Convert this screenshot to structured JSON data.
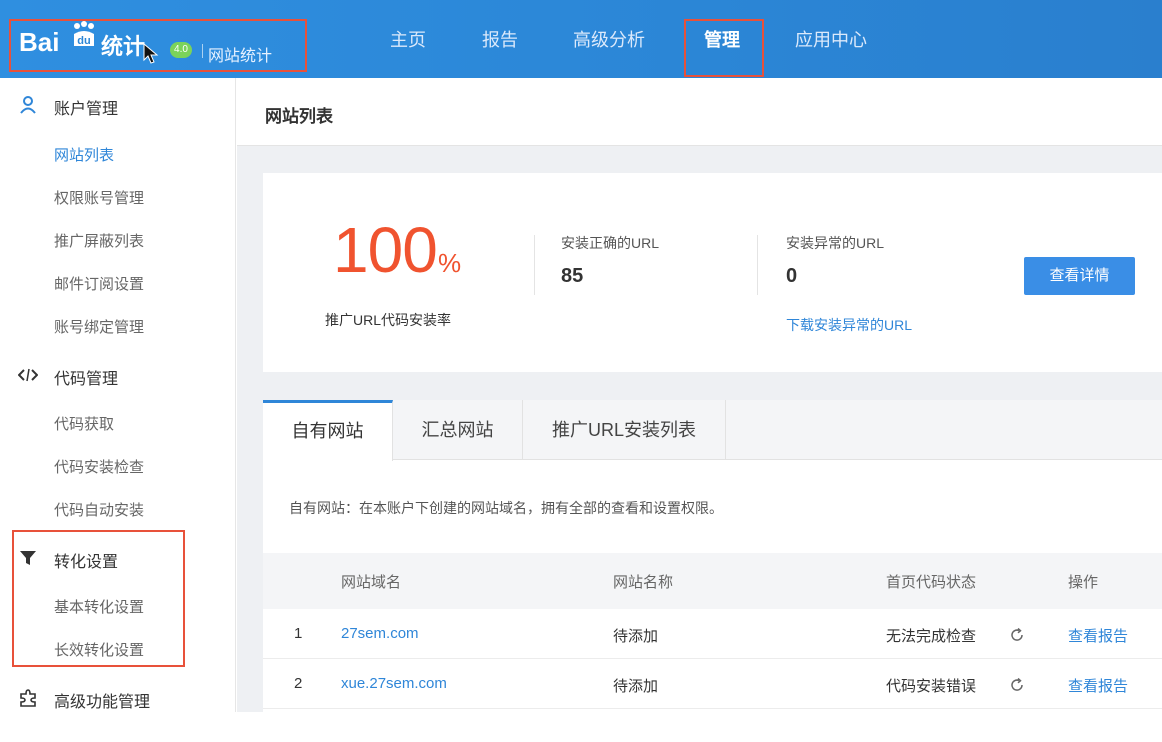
{
  "brand": {
    "logo_text_bai": "Bai",
    "logo_text_tongji": "统计",
    "badge": "4.0",
    "site_label": "网站统计"
  },
  "nav": {
    "items": [
      {
        "label": "主页"
      },
      {
        "label": "报告"
      },
      {
        "label": "高级分析"
      },
      {
        "label": "管理",
        "active": true
      },
      {
        "label": "应用中心"
      }
    ]
  },
  "sidebar": {
    "groups": [
      {
        "label": "账户管理",
        "icon": "user-icon",
        "items": [
          "网站列表",
          "权限账号管理",
          "推广屏蔽列表",
          "邮件订阅设置",
          "账号绑定管理"
        ]
      },
      {
        "label": "代码管理",
        "icon": "code-icon",
        "items": [
          "代码获取",
          "代码安装检查",
          "代码自动安装"
        ]
      },
      {
        "label": "转化设置",
        "icon": "filter-icon",
        "items": [
          "基本转化设置",
          "长效转化设置"
        ]
      },
      {
        "label": "高级功能管理",
        "icon": "puzzle-icon",
        "items": []
      }
    ],
    "active_item": "网站列表"
  },
  "main": {
    "title": "网站列表",
    "stats": {
      "rate_value": "100",
      "rate_unit": "%",
      "rate_label": "推广URL代码安装率",
      "ok_label": "安装正确的URL",
      "ok_value": "85",
      "err_label": "安装异常的URL",
      "err_value": "0",
      "download_link": "下载安装异常的URL",
      "detail_button": "查看详情"
    },
    "tabs": [
      "自有网站",
      "汇总网站",
      "推广URL安装列表"
    ],
    "tab_description": "自有网站：在本账户下创建的网站域名，拥有全部的查看和设置权限。",
    "table": {
      "columns": [
        "网站域名",
        "网站名称",
        "首页代码状态",
        "操作"
      ],
      "rows": [
        {
          "index": "1",
          "domain": "27sem.com",
          "name": "待添加",
          "status": "无法完成检查",
          "action": "查看报告"
        },
        {
          "index": "2",
          "domain": "xue.27sem.com",
          "name": "待添加",
          "status": "代码安装错误",
          "action": "查看报告"
        }
      ]
    }
  },
  "colors": {
    "topbar": "#2b86d6",
    "accent": "#2f86d8",
    "highlight_box": "#e8513a",
    "rate": "#f0532f"
  }
}
